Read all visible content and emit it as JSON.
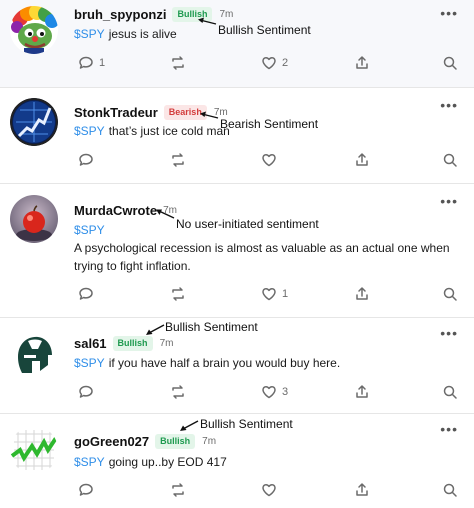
{
  "posts": [
    {
      "username": "bruh_spyponzi",
      "sentiment": "Bullish",
      "time": "7m",
      "ticker": "$SPY",
      "text": "jesus is alive",
      "comments": "1",
      "reshares": "",
      "likes": "2",
      "annotation": "Bullish Sentiment",
      "avatar_icon": "rainbow-pepe-clown-avatar"
    },
    {
      "username": "StonkTradeur",
      "sentiment": "Bearish",
      "time": "7m",
      "ticker": "$SPY",
      "text": "that’s just ice cold man",
      "comments": "",
      "reshares": "",
      "likes": "",
      "annotation": "Bearish Sentiment",
      "avatar_icon": "stock-chart-globe-avatar"
    },
    {
      "username": "MurdaCwrote",
      "sentiment": "",
      "time": "7m",
      "ticker": "$SPY",
      "text": "A psychological recession is almost as valuable as an actual one when trying to fight inflation.",
      "comments": "",
      "reshares": "",
      "likes": "1",
      "annotation": "No user-initiated sentiment",
      "avatar_icon": "red-apple-photo-avatar"
    },
    {
      "username": "sal61",
      "sentiment": "Bullish",
      "time": "7m",
      "ticker": "$SPY",
      "text": "if you have half a brain you would buy here.",
      "comments": "",
      "reshares": "",
      "likes": "3",
      "annotation": "Bullish Sentiment",
      "avatar_icon": "spartan-helmet-avatar"
    },
    {
      "username": "goGreen027",
      "sentiment": "Bullish",
      "time": "7m",
      "ticker": "$SPY",
      "text": "going up..by EOD 417",
      "comments": "",
      "reshares": "",
      "likes": "",
      "annotation": "Bullish Sentiment",
      "avatar_icon": "green-zigzag-chart-avatar"
    }
  ],
  "icons": {
    "comment": "comment-bubble-icon",
    "reshare": "reshare-arrows-icon",
    "like": "heart-icon",
    "share": "share-upload-icon",
    "search": "search-magnifier-icon",
    "more": "more-dots-icon"
  },
  "colors": {
    "ticker": "#2f8ee8",
    "bullish_text": "#1e9a4f",
    "bullish_bg": "#e3f5e9",
    "bearish_text": "#d33c3c",
    "bearish_bg": "#fbe6e6"
  }
}
